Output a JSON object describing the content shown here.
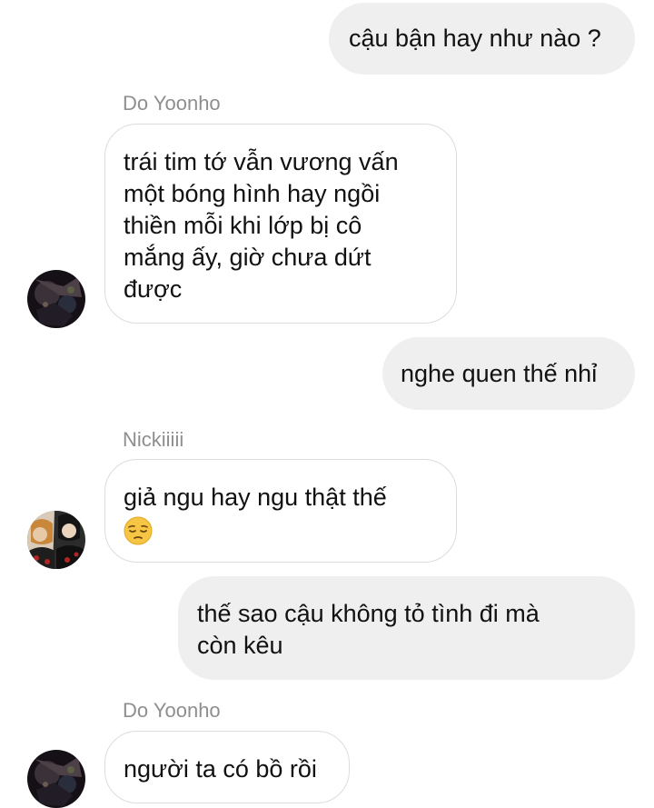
{
  "messages": [
    {
      "id": "m1",
      "direction": "outgoing",
      "lines": [
        "cậu bận hay như nào ?"
      ]
    },
    {
      "id": "m2",
      "direction": "incoming",
      "sender": "Do Yoonho",
      "lines": [
        "trái tim tớ vẫn vương vấn",
        "một bóng hình hay ngồi",
        "thiền mỗi khi lớp bị cô",
        "mắng ấy, giờ chưa dứt",
        "được"
      ]
    },
    {
      "id": "m3",
      "direction": "outgoing",
      "lines": [
        "nghe quen thế nhỉ"
      ]
    },
    {
      "id": "m4",
      "direction": "incoming",
      "sender": "Nickiiiii",
      "lines": [
        "giả ngu hay ngu thật thế"
      ],
      "emoji": "pensive-face-emoji"
    },
    {
      "id": "m5",
      "direction": "outgoing",
      "lines": [
        "thế sao cậu không tỏ tình đi mà",
        "còn kêu"
      ]
    },
    {
      "id": "m6",
      "direction": "incoming",
      "sender": "Do Yoonho",
      "lines": [
        "người ta có bồ rồi"
      ]
    }
  ],
  "colors": {
    "outgoing_bubble": "#efefef",
    "incoming_border": "#dcdcdc",
    "sender_name": "#8e8e8e",
    "text": "#111111"
  }
}
